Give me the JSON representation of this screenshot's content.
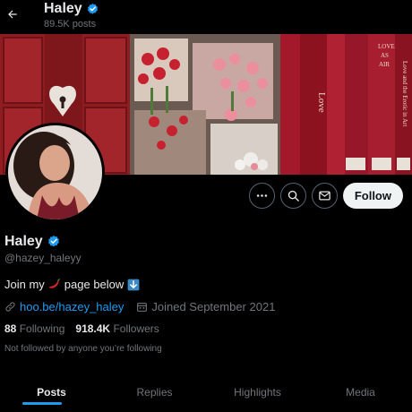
{
  "header": {
    "name": "Haley",
    "posts_count": "89.5K posts",
    "back_icon": "arrow-left-icon"
  },
  "banner": {
    "description_icon": "banner-image",
    "book_titles": [
      "Love",
      "LOVE AS AIR",
      "Love and the Erotic in Art"
    ]
  },
  "actions": {
    "more_icon": "more-horizontal-icon",
    "search_icon": "search-icon",
    "message_icon": "envelope-icon",
    "follow_label": "Follow"
  },
  "profile": {
    "name": "Haley",
    "handle": "@hazey_haleyy",
    "bio_start": "Join my",
    "bio_end": "page below",
    "link": "hoo.be/hazey_haley",
    "joined": "Joined September 2021",
    "following_count": "88",
    "following_label": "Following",
    "followers_count": "918.4K",
    "followers_label": "Followers",
    "not_followed": "Not followed by anyone you’re following"
  },
  "tabs": [
    {
      "label": "Posts"
    },
    {
      "label": "Replies"
    },
    {
      "label": "Highlights"
    },
    {
      "label": "Media"
    }
  ],
  "colors": {
    "accent": "#1d9bf0",
    "verified": "#1d9bf0",
    "background": "#000000"
  }
}
